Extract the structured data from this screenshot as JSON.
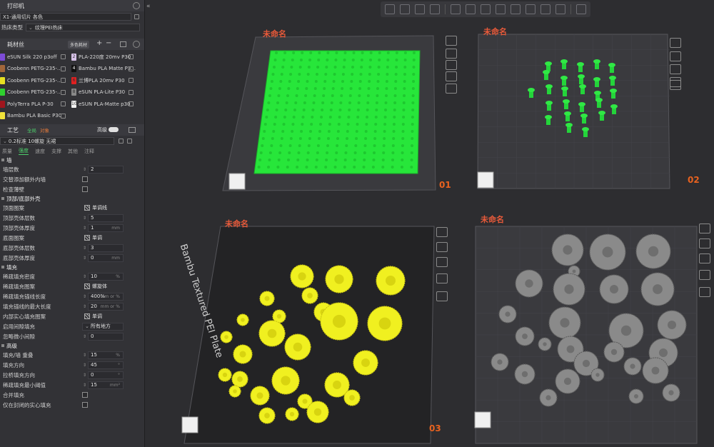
{
  "printer": {
    "section_label": "打印机",
    "name": "X1-通用切片 各色",
    "bed_label": "热床类型",
    "bed_value": "纹理PEI热床"
  },
  "filament": {
    "section_label": "耗材丝",
    "badge": "多色耗材",
    "items": [
      {
        "name": "eSUN Silk 220 p3off",
        "color": "#7c4bd6",
        "num": ""
      },
      {
        "name": "PLA-220度 20mv P30",
        "color": "#d7c2e8",
        "num": "2"
      },
      {
        "name": "Coobenn PETG-235-...",
        "color": "#a0663a",
        "num": ""
      },
      {
        "name": "Bambu PLA Matte P3...",
        "color": "#111111",
        "num": "4"
      },
      {
        "name": "Coobenn PETG-235-...",
        "color": "#e7e022",
        "num": ""
      },
      {
        "name": "兰博PLA 20mv P30",
        "color": "#e02020",
        "num": "6"
      },
      {
        "name": "Coobenn PETG-235-...",
        "color": "#2fd12f",
        "num": ""
      },
      {
        "name": "eSUN PLA-Lite  P30",
        "color": "#888888",
        "num": "8"
      },
      {
        "name": "PolyTerra PLA P-30",
        "color": "#a0151d",
        "num": ""
      },
      {
        "name": "eSUN PLA-Matte p30",
        "color": "#f2f2f2",
        "num": "10"
      },
      {
        "name": "Bambu PLA Basic P30",
        "color": "#f0e23a",
        "num": ""
      }
    ]
  },
  "process": {
    "section_label": "工艺",
    "global_label": "全局",
    "object_label": "对象",
    "advanced_label": "高级",
    "preset": "0.2标准 10螺旋 无裙",
    "tabs": [
      "质量",
      "强度",
      "速度",
      "支撑",
      "其他",
      "注释"
    ],
    "active_tab": "强度",
    "groups": {
      "wall": "墙",
      "topbottom": "顶部/底部外壳",
      "infill": "填充",
      "advanced": "高级"
    },
    "rows": {
      "wall_loops": {
        "label": "墙层数",
        "value": "2"
      },
      "alternate_wall": {
        "label": "交替添加额外内墙"
      },
      "detect_thin": {
        "label": "检查薄壁"
      },
      "top_pattern": {
        "label": "顶面图案",
        "value": "单调线"
      },
      "top_layers": {
        "label": "顶部壳体层数",
        "value": "5"
      },
      "top_thick": {
        "label": "顶部壳体厚度",
        "value": "1",
        "unit": "mm"
      },
      "bottom_pattern": {
        "label": "底面图案",
        "value": "单调"
      },
      "bottom_layers": {
        "label": "底部壳体层数",
        "value": "3"
      },
      "bottom_thick": {
        "label": "底部壳体厚度",
        "value": "0",
        "unit": "mm"
      },
      "infill_density": {
        "label": "稀疏填充密度",
        "value": "10",
        "unit": "%"
      },
      "infill_pattern": {
        "label": "稀疏填充图案",
        "value": "螺旋体"
      },
      "anchor_len": {
        "label": "稀疏填充锚线长度",
        "value": "400%",
        "unit": "mm or %"
      },
      "anchor_max": {
        "label": "填充锚线的最大长度",
        "value": "20",
        "unit": "mm or %"
      },
      "internal_solid": {
        "label": "内部实心填充图案",
        "value": "单调"
      },
      "gap_fill": {
        "label": "启用间隙填充",
        "value": "所有地方"
      },
      "filter_gaps": {
        "label": "忽略微小间隙",
        "value": "0"
      },
      "infill_overlap": {
        "label": "填充/墙 重叠",
        "value": "15",
        "unit": "%"
      },
      "infill_direction": {
        "label": "填充方向",
        "value": "45",
        "unit": "°"
      },
      "bridge_direction": {
        "label": "拉桥填充方向",
        "value": "0",
        "unit": "°"
      },
      "min_area": {
        "label": "稀疏填充最小阈值",
        "value": "15",
        "unit": "mm²"
      },
      "merge_infill": {
        "label": "合并填充"
      },
      "last": {
        "label": "仅在封闭的实心填充"
      }
    }
  },
  "plates": {
    "p1": {
      "name": "未命名",
      "number": "01"
    },
    "p2": {
      "name": "未命名",
      "number": "02"
    },
    "p3": {
      "name": "未命名",
      "number": "03",
      "label": "Bambu Textured PEI Plate"
    },
    "p4": {
      "name": "未命名",
      "number": ""
    }
  },
  "colors": {
    "accent": "#4dd06b",
    "plate_name": "#e85a3a",
    "green_model": "#27e63a",
    "yellow_model": "#f0f020",
    "gray_model": "#8a8a8a"
  }
}
